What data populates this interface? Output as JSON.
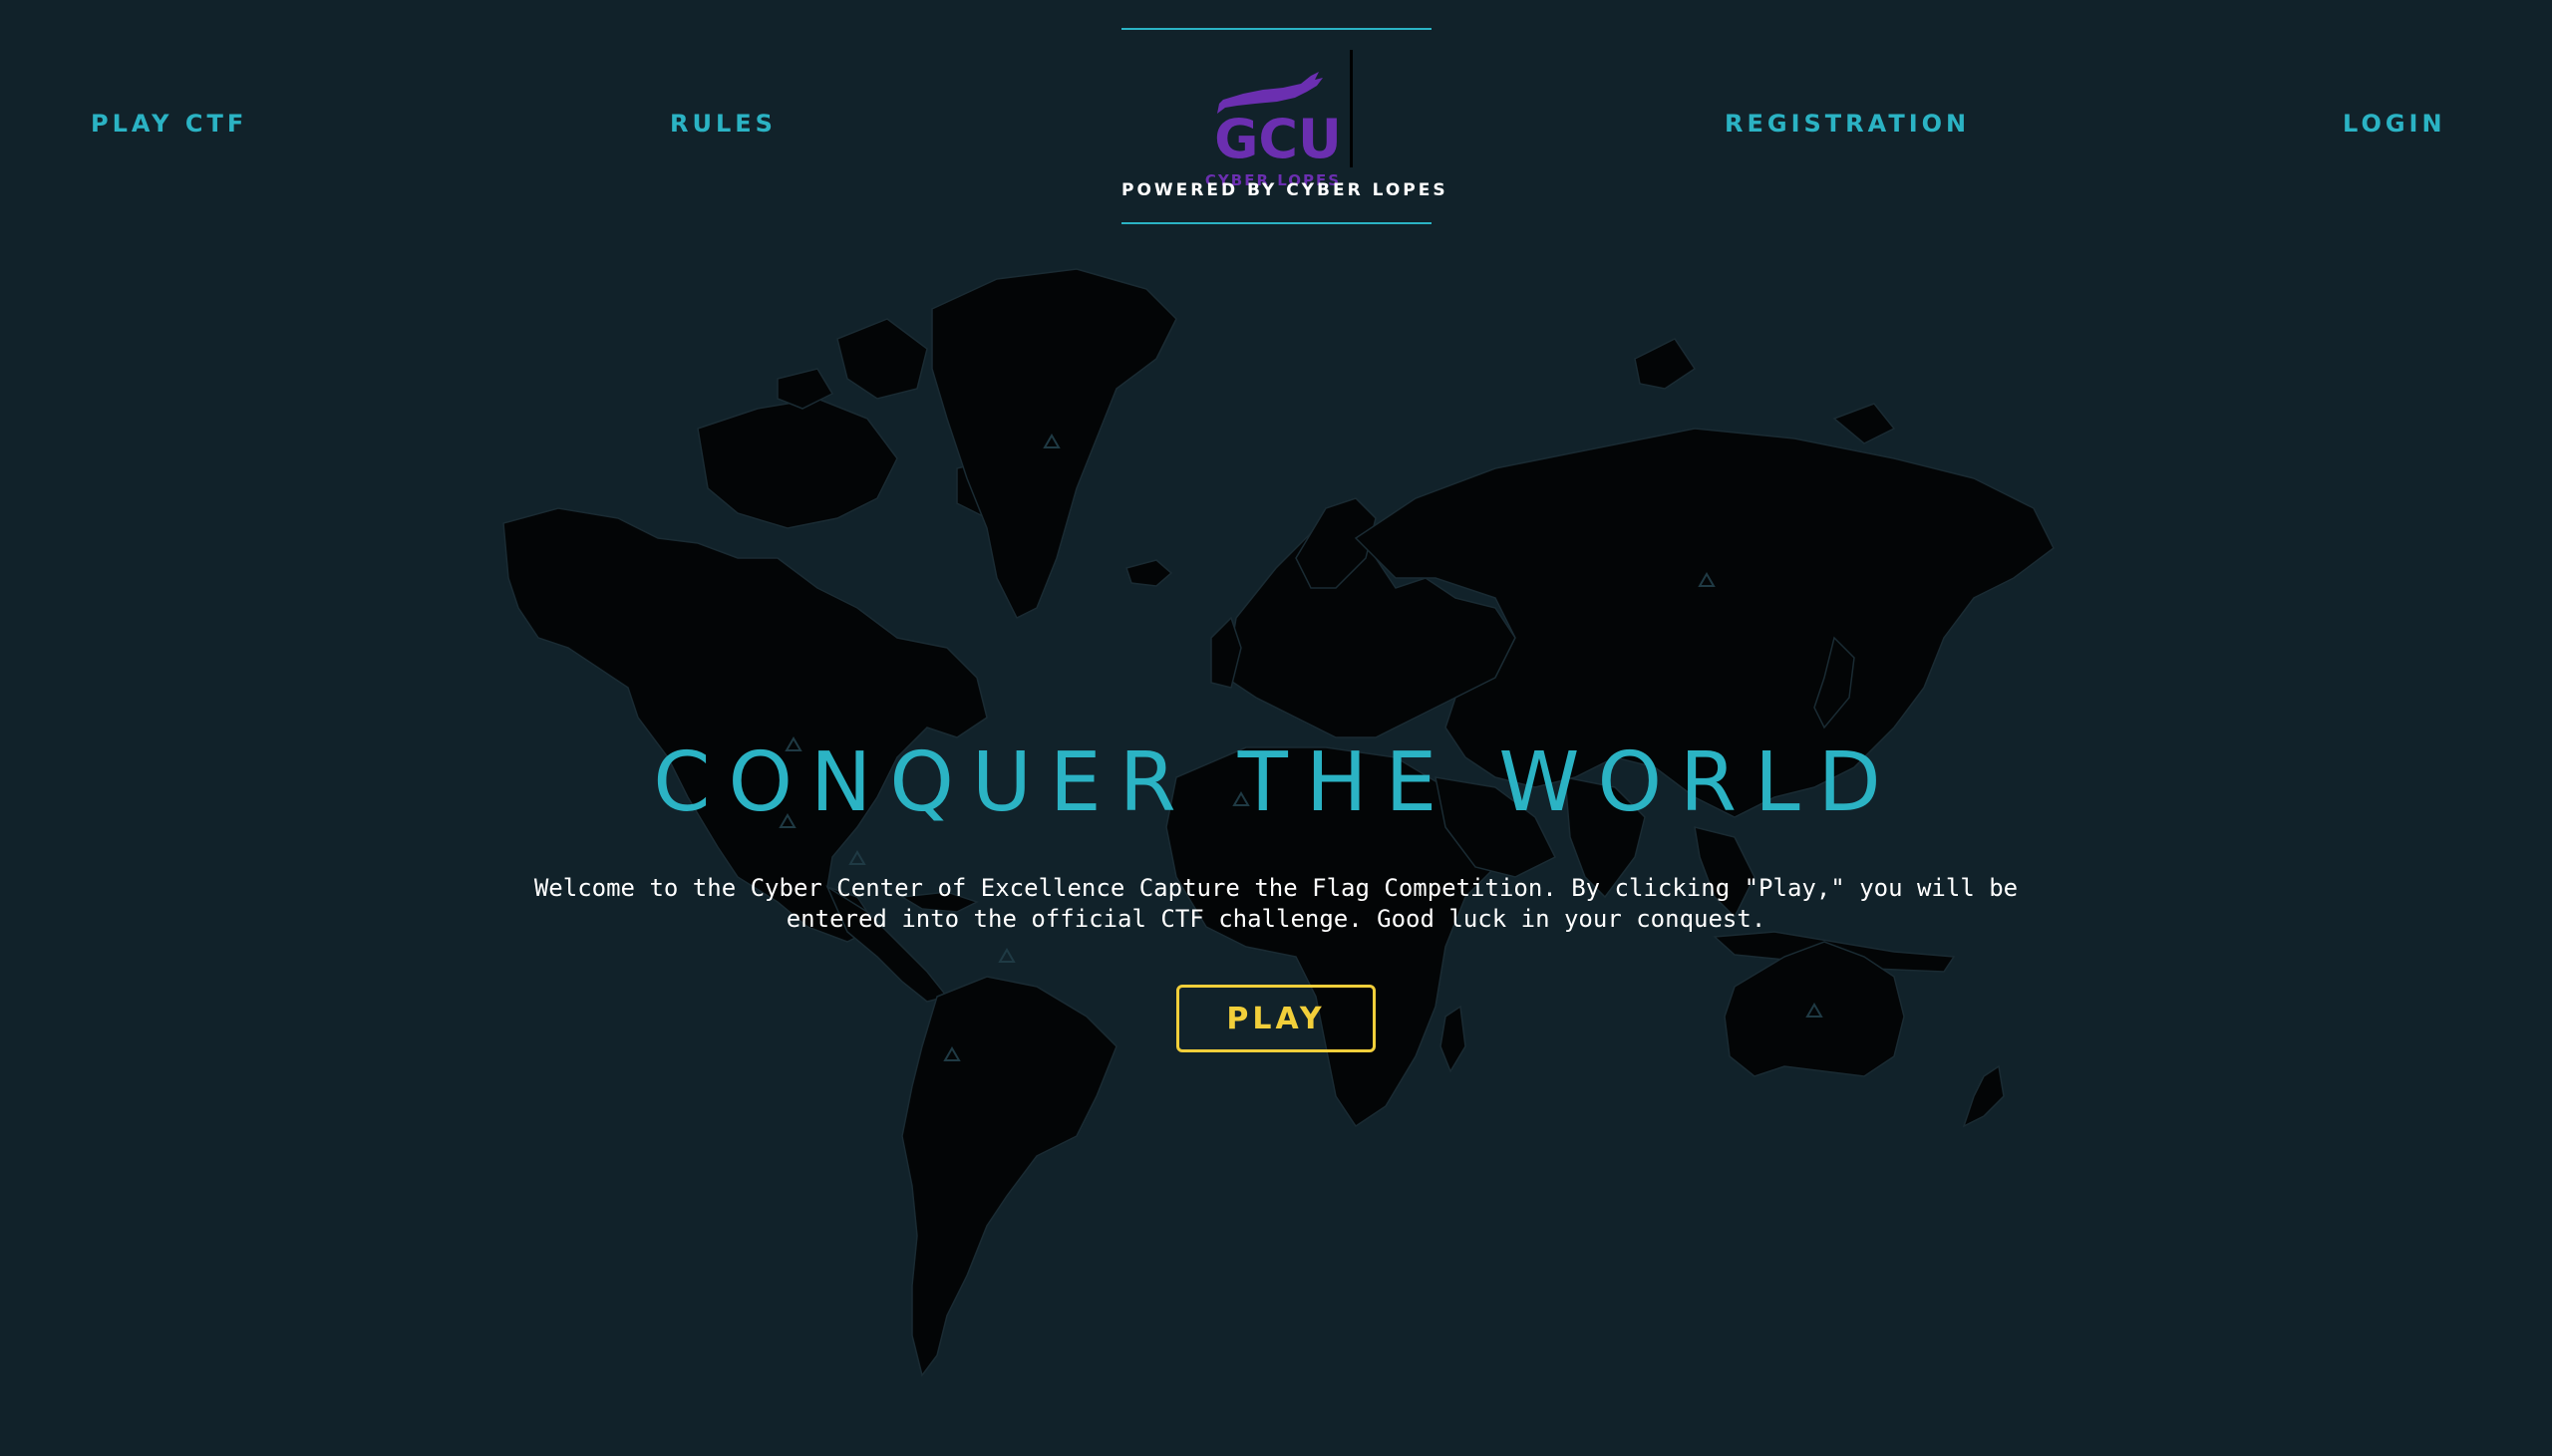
{
  "nav": {
    "play_ctf": "PLAY CTF",
    "rules": "RULES",
    "registration": "REGISTRATION",
    "login": "LOGIN"
  },
  "logo": {
    "wordmark": "GCU",
    "subtext": "CYBER LOPES",
    "caption": "POWERED BY CYBER LOPES",
    "icon": "gcu-lope-logo-icon"
  },
  "hero": {
    "title": "CONQUER THE WORLD",
    "description": "Welcome to the Cyber Center of Excellence Capture the Flag Competition. By clicking \"Play,\" you will be entered into the official CTF challenge. Good luck in your conquest.",
    "play_label": "PLAY"
  },
  "colors": {
    "background": "#11222a",
    "accent": "#2bb3c4",
    "button": "#f2cf3a",
    "logo_purple": "#6b2fb0",
    "map_land": "#030506"
  }
}
